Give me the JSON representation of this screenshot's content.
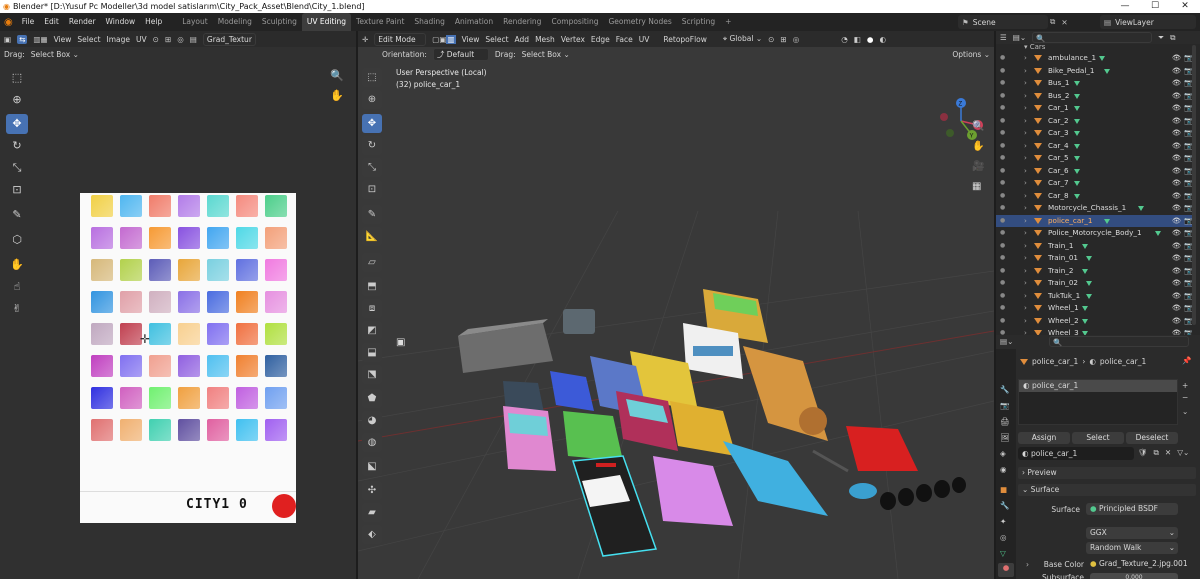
{
  "window": {
    "title": "Blender* [D:\\Yusuf Pc Modeller\\3d model satislarım\\City_Pack_Asset\\Blend\\City_1.blend]",
    "minimize": "—",
    "maximize": "☐",
    "close": "✕"
  },
  "menu": [
    "File",
    "Edit",
    "Render",
    "Window",
    "Help"
  ],
  "workspaces": [
    "Layout",
    "Modeling",
    "Sculpting",
    "UV Editing",
    "Texture Paint",
    "Shading",
    "Animation",
    "Rendering",
    "Compositing",
    "Geometry Nodes",
    "Scripting",
    "+"
  ],
  "active_workspace": "UV Editing",
  "scene": {
    "name": "Scene",
    "view_layer": "ViewLayer"
  },
  "uv_editor": {
    "menus": [
      "View",
      "Select",
      "Image",
      "UV"
    ],
    "image_name": "Grad_Textur",
    "drag_label": "Drag:",
    "drag_value": "Select Box"
  },
  "viewport": {
    "mode": "Edit Mode",
    "menus": [
      "View",
      "Select",
      "Add",
      "Mesh",
      "Vertex",
      "Edge",
      "Face",
      "UV"
    ],
    "retopo": "RetopoFlow",
    "transform": "Global",
    "orientation_label": "Orientation:",
    "orientation_value": "Default",
    "drag_label": "Drag:",
    "drag_value": "Select Box",
    "options": "Options",
    "info_line1": "User Perspective (Local)",
    "info_line2": "(32) police_car_1",
    "gizmo": {
      "x": "X",
      "y": "Y",
      "z": "Z"
    }
  },
  "outliner": {
    "collection": "Cars",
    "items": [
      "ambulance_1",
      "Bike_Pedal_1",
      "Bus_1",
      "Bus_2",
      "Car_1",
      "Car_2",
      "Car_3",
      "Car_4",
      "Car_5",
      "Car_6",
      "Car_7",
      "Car_8",
      "Motorcycle_Chassis_1",
      "police_car_1",
      "Police_Motorcycle_Body_1",
      "Train_1",
      "Train_01",
      "Train_2",
      "Train_02",
      "TukTuk_1",
      "Wheel_1",
      "Wheel_2",
      "Wheel_3"
    ],
    "selected": "police_car_1"
  },
  "properties": {
    "breadcrumb_object": "police_car_1",
    "breadcrumb_material": "police_car_1",
    "slot": "police_car_1",
    "assign": "Assign",
    "select": "Select",
    "deselect": "Deselect",
    "material_name": "police_car_1",
    "preview": "Preview",
    "surface_section": "Surface",
    "surface_label": "Surface",
    "surface_value": "Principled BSDF",
    "distribution": "GGX",
    "subsurface_method": "Random Walk",
    "base_color_label": "Base Color",
    "base_color_value": "Grad_Texture_2.jpg.001",
    "subsurface_label": "Subsurface",
    "subsurface_value": "0.000"
  },
  "texture": {
    "label_text": "CITY1 0",
    "colors": [
      [
        "#f1d046",
        "#4fb6f0",
        "#f07c6a",
        "#b27ce8",
        "#5ad8d0",
        "#f58a7e",
        "#4cce8a"
      ],
      [
        "#b86fe0",
        "#c36ad0",
        "#f69a34",
        "#8852e0",
        "#42a6f0",
        "#4fd8e6",
        "#f3a07a"
      ],
      [
        "#d6b87a",
        "#b2d14c",
        "#5c5cb8",
        "#e8a63a",
        "#7ad0e0",
        "#6070e0",
        "#f07ae0"
      ],
      [
        "#3294e0",
        "#e0a0a8",
        "#d0b0c0",
        "#8a70e6",
        "#4a6ce0",
        "#f08020",
        "#e690e0"
      ],
      [
        "#c0a8c0",
        "#c04050",
        "#40c0e0",
        "#f8d090",
        "#8070f0",
        "#f07040",
        "#b0e040"
      ],
      [
        "#c040c0",
        "#8070f0",
        "#f0a090",
        "#9060e0",
        "#50c0f0",
        "#f08030",
        "#3060a0"
      ],
      [
        "#3030e0",
        "#d060c0",
        "#70f070",
        "#f0a040",
        "#f08080",
        "#c060e0",
        "#70a0f0"
      ],
      [
        "#e07070",
        "#f0b070",
        "#40d0b0",
        "#6050a0",
        "#e060a0",
        "#40c0f0",
        "#a060f0"
      ]
    ]
  },
  "colors": {
    "accent": "#4772b3",
    "selection": "#334d80"
  }
}
